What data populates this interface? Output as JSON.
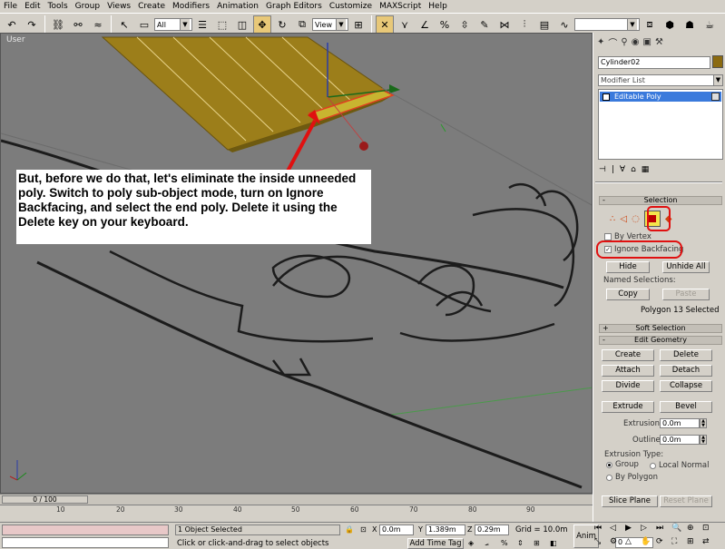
{
  "menu": [
    "File",
    "Edit",
    "Tools",
    "Group",
    "Views",
    "Create",
    "Modifiers",
    "Animation",
    "Graph Editors",
    "Customize",
    "MAXScript",
    "Help"
  ],
  "toolbar": {
    "selection_filter": "All",
    "ref_coord": "View"
  },
  "viewport": {
    "label": "User"
  },
  "callout": {
    "text": "But, before we do that, let's eliminate the inside unneeded poly.  Switch to poly sub-object mode, turn on Ignore Backfacing, and select the end poly.  Delete it using the Delete key on your keyboard."
  },
  "command_panel": {
    "object_name": "Cylinder02",
    "modifier_list": "Modifier List",
    "stack_item": "Editable Poly",
    "selection": {
      "header": "Selection",
      "by_vertex": "By Vertex",
      "ignore_backfacing": "Ignore Backfacing",
      "hide": "Hide",
      "unhide_all": "Unhide All",
      "named_selections": "Named Selections:",
      "copy": "Copy",
      "paste": "Paste",
      "status": "Polygon 13 Selected"
    },
    "soft_selection": "Soft Selection",
    "edit_geometry": {
      "header": "Edit Geometry",
      "create": "Create",
      "delete": "Delete",
      "attach": "Attach",
      "detach": "Detach",
      "divide": "Divide",
      "collapse": "Collapse",
      "extrude": "Extrude",
      "bevel": "Bevel",
      "extrusion_label": "Extrusion:",
      "extrusion_value": "0.0m",
      "outline_label": "Outline",
      "outline_value": "0.0m",
      "extrusion_type": "Extrusion Type:",
      "group": "Group",
      "local_normal": "Local Normal",
      "by_polygon": "By Polygon",
      "slice_plane": "Slice Plane",
      "reset_plane": "Reset Plane"
    }
  },
  "timeline": {
    "slider": "0 / 100",
    "ticks": [
      "10",
      "20",
      "30",
      "40",
      "50",
      "60",
      "70",
      "80",
      "90"
    ]
  },
  "status": {
    "selected": "1 Object Selected",
    "prompt": "Click or click-and-drag to select objects",
    "x_label": "X",
    "x_value": "0.0m",
    "y_label": "Y",
    "y_value": "1.389m",
    "z_label": "Z",
    "z_value": "0.29m",
    "grid": "Grid = 10.0m",
    "add_time_tag": "Add Time Tag",
    "anim": "Anim",
    "frame": "0"
  },
  "colors": {
    "viewport_bg": "#7b7b7b",
    "object_color": "#8b6a10",
    "highlight_red": "#e01010",
    "stack_select": "#3a7adc"
  }
}
